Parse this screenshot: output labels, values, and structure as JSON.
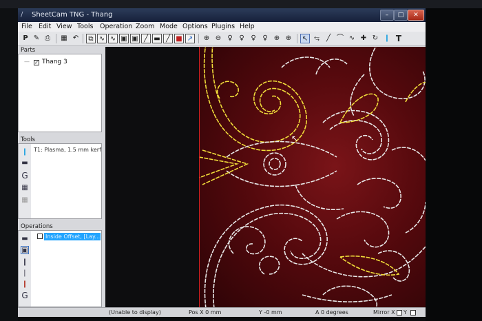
{
  "window": {
    "title": "SheetCam TNG - Thang"
  },
  "menu": [
    "File",
    "Edit",
    "View",
    "Tools",
    "Operation",
    "Zoom",
    "Mode",
    "Options",
    "Plugins",
    "Help"
  ],
  "parts": {
    "header": "Parts",
    "item": "Thang 3",
    "checked": true
  },
  "tools": {
    "header": "Tools",
    "item": "T1: Plasma, 1.5 mm kerf"
  },
  "operations": {
    "header": "Operations",
    "item": "Inside Offset, [Lay..."
  },
  "status": {
    "message": "(Unable to display)",
    "pos_x": "Pos X  0 mm",
    "y": "Y  -0 mm",
    "angle": "A  0 degrees",
    "mirror_x": "Mirror X",
    "mirror_y": "Y"
  },
  "colors": {
    "canvas": "#6a0f14",
    "path": "#e8e8e8",
    "selected_path": "#f0dc3a",
    "axis": "#d02020",
    "selection": "#22a4ff"
  }
}
